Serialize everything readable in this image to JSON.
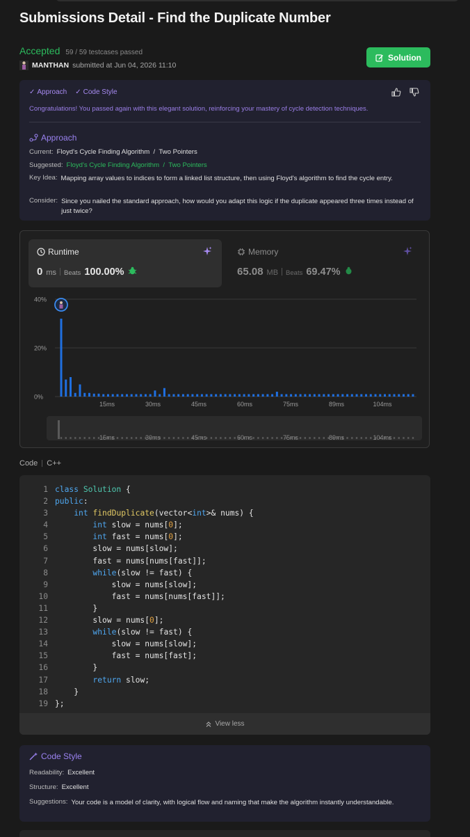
{
  "page": {
    "title": "Submissions Detail - Find the Duplicate Number",
    "status": "Accepted",
    "testcases": "59 / 59 testcases passed",
    "user": "MANTHAN",
    "submitted_at": "submitted at Jun 04, 2026 11:10",
    "solution_label": "Solution"
  },
  "analysis": {
    "chips": [
      "Approach",
      "Code Style"
    ],
    "congrats": "Congratulations! You passed again with this elegant solution, reinforcing your mastery of cycle detection techniques.",
    "approach_title": "Approach",
    "current_label": "Current:",
    "current_value": "Floyd's Cycle Finding Algorithm  /  Two Pointers",
    "suggested_label": "Suggested:",
    "suggested_value": "Floyd's Cycle Finding Algorithm  /  Two Pointers",
    "key_idea_label": "Key Idea:",
    "key_idea_value": "Mapping array values to indices to form a linked list structure, then using Floyd's algorithm to find the cycle entry.",
    "consider_label": "Consider:",
    "consider_value": "Since you nailed the standard approach, how would you adapt this logic if the duplicate appeared three times instead of just twice?"
  },
  "performance": {
    "runtime": {
      "label": "Runtime",
      "value": "0",
      "unit": "ms",
      "beats_label": "Beats",
      "beats_value": "100.00%"
    },
    "memory": {
      "label": "Memory",
      "value": "65.08",
      "unit": "MB",
      "beats_label": "Beats",
      "beats_value": "69.47%"
    }
  },
  "chart_data": {
    "type": "bar",
    "xlabel": "",
    "ylabel": "",
    "ylim": [
      0,
      40
    ],
    "yticks": [
      "40%",
      "20%",
      "0%"
    ],
    "xticks": [
      "15ms",
      "30ms",
      "45ms",
      "60ms",
      "75ms",
      "89ms",
      "104ms"
    ],
    "values": [
      32,
      7,
      8,
      1.5,
      5,
      1.5,
      1.5,
      1.2,
      1.2,
      1,
      1,
      1,
      1,
      1,
      1,
      1,
      1,
      1,
      1,
      1,
      2.5,
      1,
      3.5,
      1,
      1,
      1,
      1,
      1,
      1,
      1,
      1,
      1,
      1,
      1,
      1,
      1,
      1,
      1,
      1,
      1,
      1,
      1,
      1,
      1,
      1,
      1,
      2,
      1,
      1,
      1,
      1,
      1,
      1,
      1,
      1,
      1,
      1,
      1,
      1,
      1,
      1,
      1,
      1,
      1,
      1,
      1,
      1,
      1,
      1,
      1,
      1,
      1,
      1,
      1,
      1,
      1
    ],
    "highlight_index": 0,
    "grid": true,
    "colors": {
      "bar": "#1f6fe0",
      "highlight_ring": "#3b8bf0"
    }
  },
  "code": {
    "label": "Code",
    "language": "C++",
    "view_less": "View less",
    "lines": [
      "class Solution {",
      "public:",
      "    int findDuplicate(vector<int>& nums) {",
      "        int slow = nums[0];",
      "        int fast = nums[0];",
      "        slow = nums[slow];",
      "        fast = nums[nums[fast]];",
      "        while(slow != fast) {",
      "            slow = nums[slow];",
      "            fast = nums[nums[fast]];",
      "        }",
      "        slow = nums[0];",
      "        while(slow != fast) {",
      "            slow = nums[slow];",
      "            fast = nums[fast];",
      "        }",
      "        return slow;",
      "    }",
      "};"
    ]
  },
  "code_style": {
    "title": "Code Style",
    "readability_label": "Readability:",
    "readability_value": "Excellent",
    "structure_label": "Structure:",
    "structure_value": "Excellent",
    "suggestions_label": "Suggestions:",
    "suggestions_value": "Your code is a model of clarity, with logical flow and naming that make the algorithm instantly understandable."
  },
  "colors": {
    "accent_green": "#2cbb5d",
    "accent_purple": "#9a82f0",
    "background": "#1a1a1a"
  }
}
